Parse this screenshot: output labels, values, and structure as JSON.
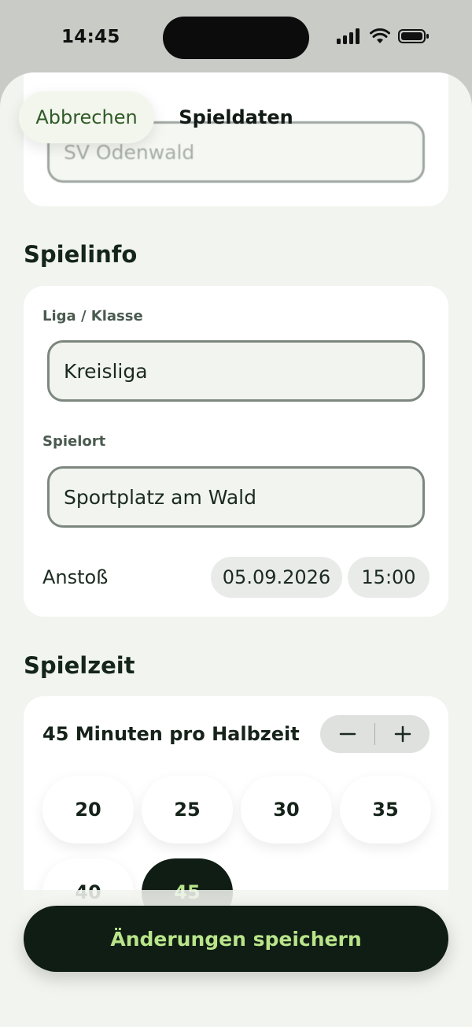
{
  "status_bar": {
    "time": "14:45"
  },
  "header": {
    "cancel_label": "Abbrechen",
    "title": "Spieldaten"
  },
  "opponent": {
    "value": "SV Odenwald"
  },
  "spielinfo": {
    "title": "Spielinfo",
    "league_label": "Liga / Klasse",
    "league_value": "Kreisliga",
    "venue_label": "Spielort",
    "venue_value": "Sportplatz am Wald",
    "kickoff_label": "Anstoß",
    "kickoff_date": "05.09.2026",
    "kickoff_time": "15:00"
  },
  "spielzeit": {
    "title": "Spielzeit",
    "minutes_label": "45 Minuten pro Halbzeit",
    "options": [
      "20",
      "25",
      "30",
      "35",
      "40",
      "45"
    ],
    "selected": "45"
  },
  "save_label": "Änderungen speichern",
  "colors": {
    "accent_dark": "#0f1d14",
    "accent_light": "#b9e48a",
    "cancel_text": "#2f5a27"
  }
}
